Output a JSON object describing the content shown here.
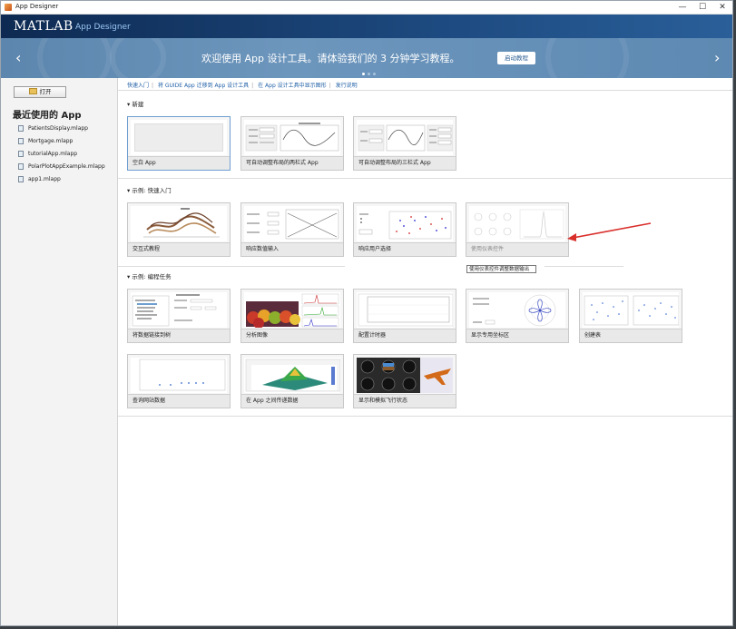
{
  "window": {
    "title": "App Designer",
    "controls": [
      "—",
      "☐",
      "✕"
    ]
  },
  "banner": {
    "logo": "MATLAB",
    "logo_sub": "App Designer",
    "message": "欢迎使用 App 设计工具。请体验我们的 3 分钟学习教程。",
    "tour_button": "启动教程",
    "prev_arrow": "‹",
    "next_arrow": "›",
    "page_dots": 3,
    "active_dot": 1
  },
  "sidebar": {
    "open_button": "打开",
    "recent_title": "最近使用的 App",
    "recent": [
      "PatientsDisplay.mlapp",
      "Mortgage.mlapp",
      "tutorialApp.mlapp",
      "PolarPlotAppExample.mlapp",
      "app1.mlapp"
    ]
  },
  "links": [
    "快速入门",
    "将 GUIDE App 迁移到 App 设计工具",
    "在 App 设计工具中显示图形",
    "发行说明"
  ],
  "sections": {
    "new": {
      "title": "▾ 新建",
      "cards": [
        "空白 App",
        "可自动调整布局的两栏式 App",
        "可自动调整布局的三栏式 App"
      ]
    },
    "quickstart": {
      "title": "▾ 示例: 快速入门",
      "cards": [
        "交互式教程",
        "响应数值输入",
        "响应用户选择",
        "使用仪表控件"
      ]
    },
    "programming": {
      "title": "▾ 示例: 编程任务",
      "cards": [
        "将数据链接到树",
        "分析图像",
        "配置计时器",
        "显示专用坐标区",
        "创建表",
        "查询网站数据",
        "在 App 之间传递数据",
        "显示和模拟飞行状态"
      ]
    }
  },
  "tooltip": "使用仪表控件调整数据输出",
  "colors": {
    "banner_dark": "#0e2a52",
    "banner_main": "#6d96bd",
    "link": "#1f5fa6",
    "selection": "#6f9fd1",
    "annotation_arrow": "#d9302c"
  }
}
